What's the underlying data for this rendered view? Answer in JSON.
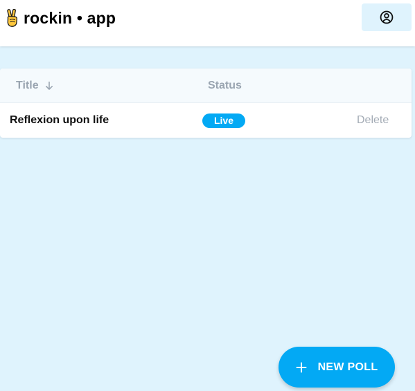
{
  "app": {
    "title": "rockin • app",
    "brand_icon": "victory-hand-icon",
    "account_icon": "account-circle-icon"
  },
  "table": {
    "columns": [
      {
        "label": "Title",
        "sortable": true,
        "sort_direction": "descending",
        "sort_icon": "arrow-down-icon"
      },
      {
        "label": "Status",
        "sortable": false
      }
    ],
    "rows": [
      {
        "title": "Reflexion upon life",
        "status": "Live",
        "action": "Delete"
      }
    ]
  },
  "fab": {
    "label": "NEW POLL",
    "icon": "plus-icon"
  },
  "colors": {
    "background": "#dff3fd",
    "accent": "#03a9f4",
    "header_text": "#9aa5b1",
    "muted_action": "#a3abb5"
  }
}
